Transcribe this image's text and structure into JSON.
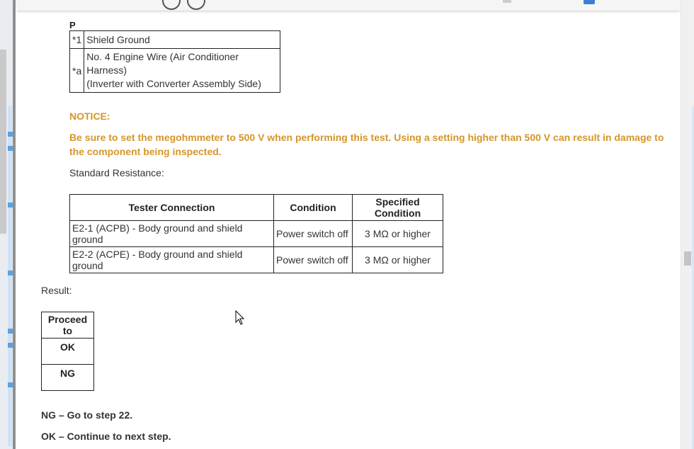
{
  "connector": {
    "label": "P",
    "legend": [
      {
        "key": "*1",
        "text": "Shield Ground"
      },
      {
        "key": "*a",
        "text_line1": "No. 4 Engine Wire (Air Conditioner Harness)",
        "text_line2": "(Inverter with Converter Assembly Side)"
      }
    ]
  },
  "notice": {
    "title": "NOTICE:",
    "body": "Be sure to set the megohmmeter to 500 V when performing this test. Using a setting higher than 500 V can result in damage to the component being inspected."
  },
  "standard": {
    "label": "Standard Resistance:",
    "headers": [
      "Tester Connection",
      "Condition",
      "Specified Condition"
    ],
    "rows": [
      [
        "E2-1 (ACPB) - Body ground and shield ground",
        "Power switch off",
        "3 MΩ or higher"
      ],
      [
        "E2-2 (ACPE) - Body ground and shield ground",
        "Power switch off",
        "3 MΩ or higher"
      ]
    ]
  },
  "result": {
    "label": "Result:",
    "header": "Proceed to",
    "options": [
      "OK",
      "NG"
    ]
  },
  "instructions": {
    "ng": "NG – Go to step 22.",
    "ok": "OK – Continue to next step."
  },
  "colors": {
    "notice": "#d4962a",
    "accent_blue": "#3b7fd4"
  }
}
